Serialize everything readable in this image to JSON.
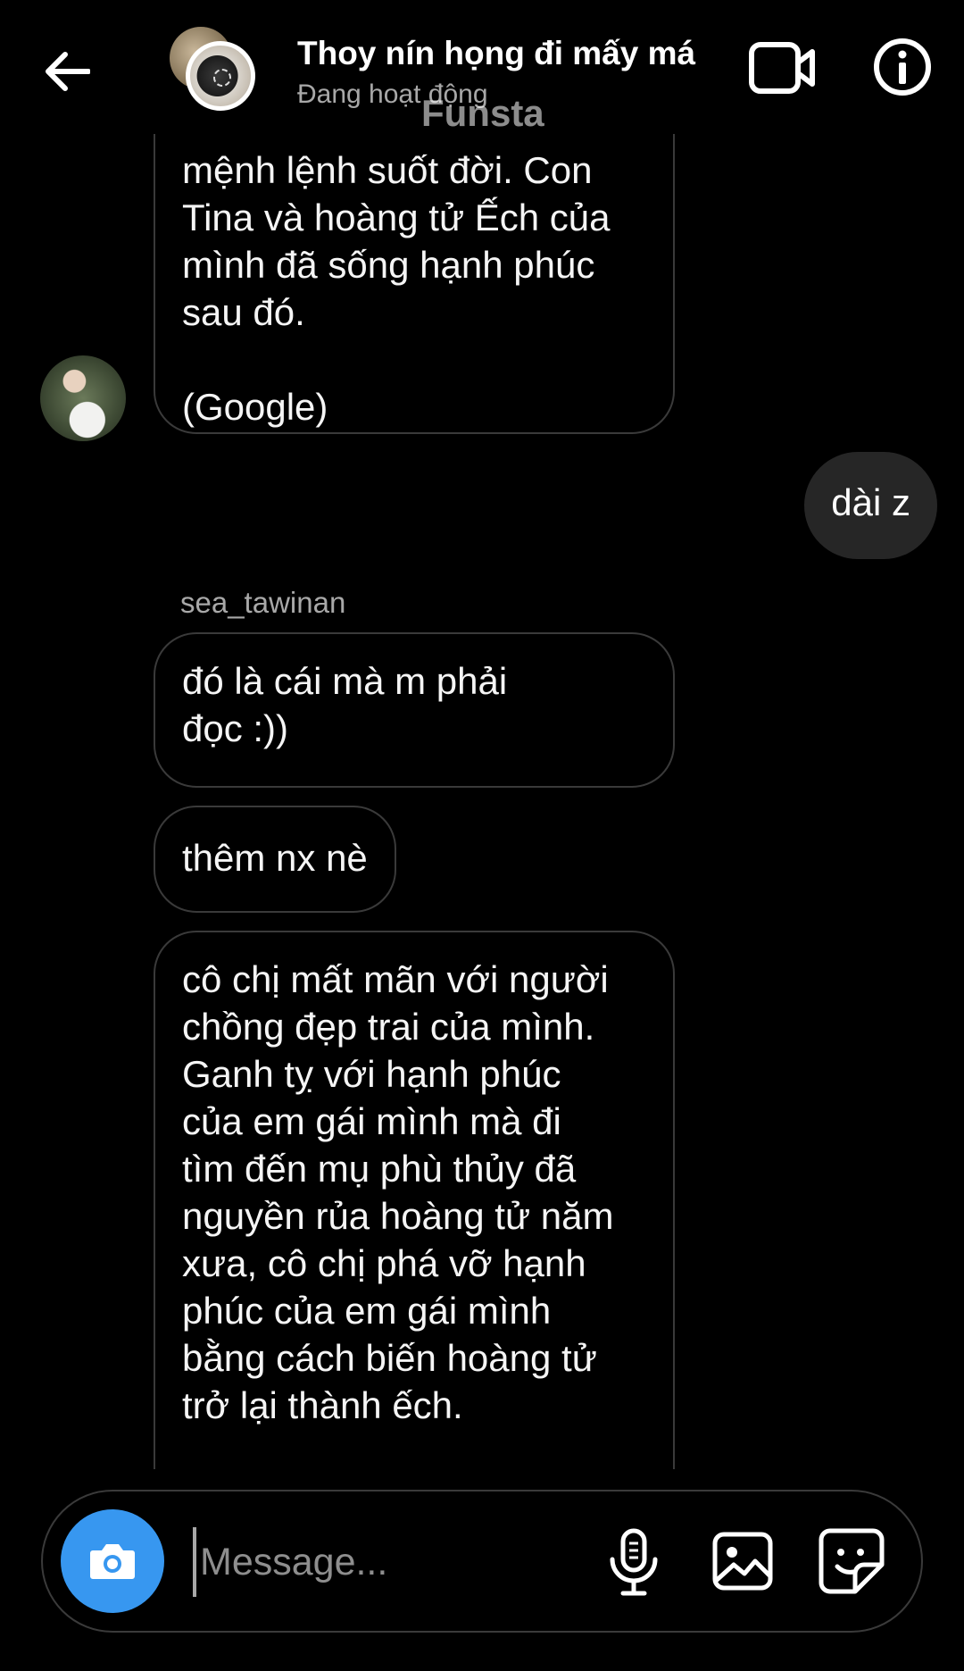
{
  "header": {
    "title": "Thoy nín họng đi mấy má",
    "status": "Đang hoạt động",
    "watermark": "Funsta",
    "icons": {
      "back": "arrow-left-icon",
      "video": "video-camera-icon",
      "info": "info-icon"
    }
  },
  "messages": {
    "first_message": "mệnh lệnh suốt đời. Con\nTina và hoàng tử Ếch của\nmình đã sống hạnh phúc\nsau đó.\n\n(Google)",
    "reply_out": "dài z",
    "sender": "sea_tawinan",
    "msg2": "đó là cái mà m phải\nđọc :))",
    "msg3": "thêm nx nè",
    "msg4": "cô chị mất mãn với người\nchồng đẹp trai của mình.\nGanh tỵ với hạnh phúc\ncủa em gái mình mà đi\ntìm đến mụ phù thủy đã\nnguyền rủa hoàng tử năm\nxưa, cô chị phá vỡ hạnh\nphúc của em gái mình\nbằng cách biến hoàng tử\ntrở lại thành ếch."
  },
  "composer": {
    "placeholder": "Message...",
    "icons": {
      "camera": "camera-icon",
      "mic": "microphone-icon",
      "gallery": "image-icon",
      "sticker": "sticker-icon"
    }
  },
  "colors": {
    "background": "#000000",
    "outgoing_bubble": "#262626",
    "incoming_border": "#3a3a3a",
    "camera_button": "#3797f0",
    "secondary_text": "#a8a8a8"
  }
}
